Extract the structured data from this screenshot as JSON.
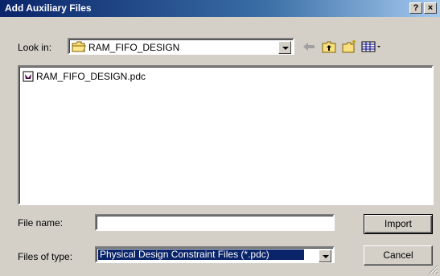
{
  "window": {
    "title": "Add Auxiliary Files",
    "help_label": "?",
    "close_label": "×"
  },
  "lookin": {
    "label": "Look in:",
    "value": "RAM_FIFO_DESIGN"
  },
  "toolbar": {
    "icons": [
      "back-arrow-icon",
      "up-folder-icon",
      "new-folder-icon",
      "view-menu-icon"
    ]
  },
  "files": [
    {
      "name": "RAM_FIFO_DESIGN.pdc"
    }
  ],
  "filename": {
    "label": "File name:",
    "value": ""
  },
  "filetype": {
    "label": "Files of type:",
    "value": "Physical Design Constraint Files (*.pdc)"
  },
  "buttons": {
    "import": "Import",
    "cancel": "Cancel"
  },
  "colors": {
    "title_bar": "#0a246a",
    "face": "#d4d0c8",
    "selection": "#0a246a"
  }
}
